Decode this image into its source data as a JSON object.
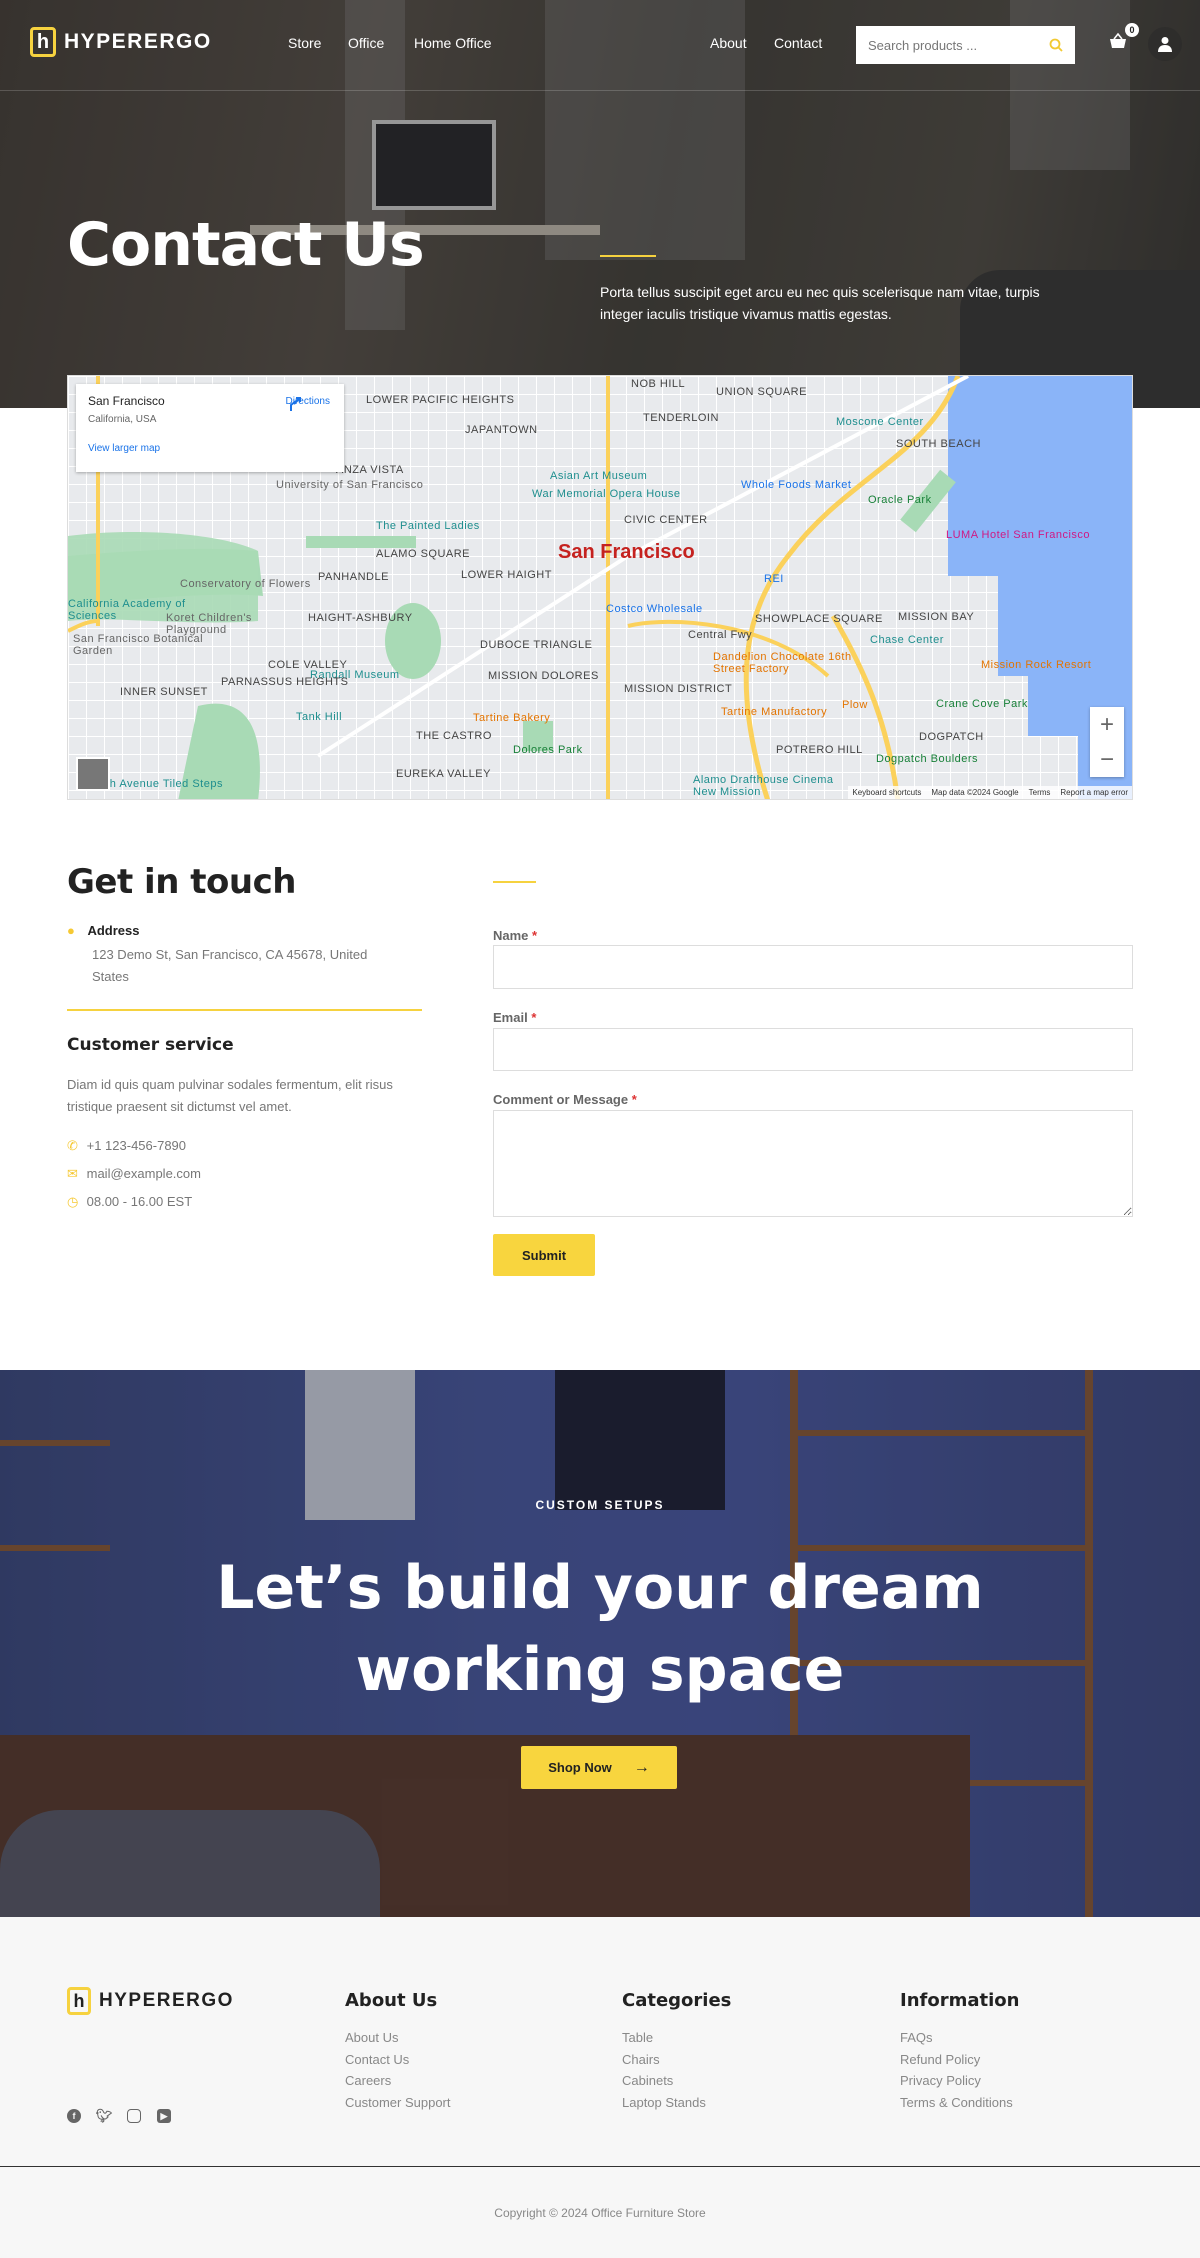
{
  "header": {
    "brand": "HYPERERGO",
    "brand_letter": "h",
    "nav_left": [
      "Store",
      "Office",
      "Home Office"
    ],
    "nav_right": [
      "About",
      "Contact"
    ],
    "search_placeholder": "Search products ...",
    "cart_count": "0"
  },
  "hero": {
    "title": "Contact Us",
    "text": "Porta tellus suscipit eget arcu eu nec quis scelerisque nam vitae, turpis integer iaculis tristique vivamus mattis egestas."
  },
  "map": {
    "place_name": "San Francisco",
    "place_region": "California, USA",
    "directions": "Directions",
    "view_larger": "View larger map",
    "city_label": "San Francisco",
    "labels": [
      "LOWER PACIFIC HEIGHTS",
      "JAPANTOWN",
      "ANZA VISTA",
      "University of San Francisco",
      "The Painted Ladies",
      "ALAMO SQUARE",
      "LOWER HAIGHT",
      "PANHANDLE",
      "Conservatory of Flowers",
      "California Academy of Sciences",
      "Koret Children's Playground",
      "San Francisco Botanical Garden",
      "HAIGHT-ASHBURY",
      "COLE VALLEY",
      "DUBOCE TRIANGLE",
      "Randall Museum",
      "INNER SUNSET",
      "PARNASSUS HEIGHTS",
      "Tank Hill",
      "THE CASTRO",
      "Tartine Bakery",
      "Dolores Park",
      "EUREKA VALLEY",
      "MISSION DOLORES",
      "16th Avenue Tiled Steps",
      "NOB HILL",
      "UNION SQUARE",
      "TENDERLOIN",
      "Moscone Center",
      "SOUTH BEACH",
      "Asian Art Museum",
      "War Memorial Opera House",
      "Whole Foods Market",
      "Oracle Park",
      "CIVIC CENTER",
      "LUMA Hotel San Francisco",
      "REI",
      "Costco Wholesale",
      "SHOWPLACE SQUARE",
      "MISSION BAY",
      "Chase Center",
      "Central Fwy",
      "Dandelion Chocolate 16th Street Factory",
      "Mission Rock Resort",
      "MISSION DISTRICT",
      "Tartine Manufactory",
      "Plow",
      "Crane Cove Park",
      "DOGPATCH",
      "Dogpatch Boulders",
      "POTRERO HILL",
      "Alamo Drafthouse Cinema New Mission"
    ],
    "zoom_in": "+",
    "zoom_out": "−",
    "attribution": [
      "Keyboard shortcuts",
      "Map data ©2024 Google",
      "Terms",
      "Report a map error"
    ]
  },
  "contact": {
    "heading": "Get in touch",
    "address_label": "Address",
    "address": "123 Demo St, San Francisco, CA 45678, United States",
    "service_heading": "Customer service",
    "service_text": "Diam id quis quam pulvinar sodales fermentum, elit risus tristique praesent sit dictumst vel amet.",
    "phone": "+1 123-456-7890",
    "email": "mail@example.com",
    "hours": "08.00 - 16.00 EST"
  },
  "form": {
    "name_label": "Name",
    "email_label": "Email",
    "message_label": "Comment or Message",
    "required_mark": "*",
    "submit": "Submit"
  },
  "cta": {
    "eyebrow": "CUSTOM SETUPS",
    "headline_1": "Let’s build your dream",
    "headline_2": "working space",
    "button": "Shop Now",
    "button_arrow": "→"
  },
  "footer": {
    "brand": "HYPERERGO",
    "columns": [
      {
        "title": "About Us",
        "links": [
          "About Us",
          "Contact Us",
          "Careers",
          "Customer Support"
        ]
      },
      {
        "title": "Categories",
        "links": [
          "Table",
          "Chairs",
          "Cabinets",
          "Laptop Stands"
        ]
      },
      {
        "title": "Information",
        "links": [
          "FAQs",
          "Refund Policy",
          "Privacy Policy",
          "Terms & Conditions"
        ]
      }
    ],
    "social": [
      "facebook-icon",
      "twitter-icon",
      "instagram-icon",
      "youtube-icon"
    ],
    "copyright": "Copyright © 2024 Office Furniture Store"
  },
  "colors": {
    "accent": "#f8d53e",
    "required": "#dd3333",
    "footer_bg": "#f7f7f7"
  }
}
